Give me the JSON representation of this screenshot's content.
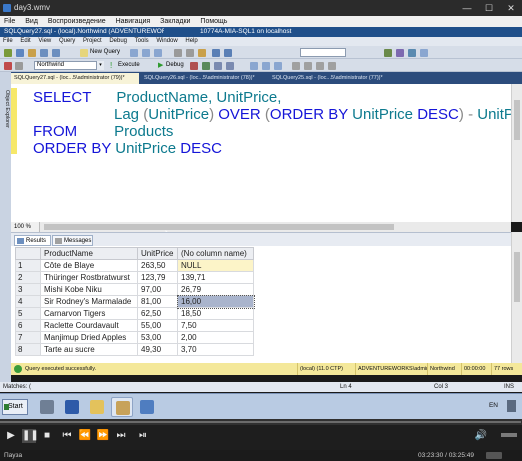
{
  "player": {
    "title": "day3.wmv",
    "menu": [
      "File",
      "Вид",
      "Воспроизведение",
      "Навигация",
      "Закладки",
      "Помощь"
    ],
    "status_text": "Пауза",
    "time_text": "03:23:30 / 03:25:49"
  },
  "ssms": {
    "title": "SQLQuery27.sql - (local).Northwind (ADVENTUREWORKS\\administrator (79))* - Microsoft SQL Server Management Studio",
    "remote_title": "10774A-MIA-SQL1 on localhost",
    "menu": [
      "File",
      "Edit",
      "View",
      "Query",
      "Project",
      "Debug",
      "Tools",
      "Window",
      "Help"
    ],
    "toolbar": {
      "new_query_label": "New Query",
      "database_value": "Northwind",
      "execute_label": "Execute",
      "debug_label": "Debug"
    },
    "tabs": [
      "SQLQuery27.sql - (loc...5\\administrator (79))*",
      "SQLQuery26.sql - (loc...5\\administrator (78))*",
      "SQLQuery25.sql - (loc...5\\administrator (77))*"
    ],
    "object_explorer_label": "Object Explorer",
    "zoom": "100 %",
    "sql": {
      "line1_kw": "SELECT",
      "line1_cols": "ProductName, UnitPrice,",
      "line2_fn": "Lag",
      "line2_open": "(",
      "line2_arg": "UnitPrice",
      "line2_close": ")",
      "line2_over": "OVER",
      "line2_paren_open": "(",
      "line2_orderby": "ORDER BY",
      "line2_col": "UnitPrice",
      "line2_desc": "DESC",
      "line2_paren_close": ")",
      "line2_minus": "-",
      "line2_tail": "UnitP",
      "line3_kw": "FROM",
      "line3_tbl": "Products",
      "line4_kw": "ORDER BY",
      "line4_col": "UnitPrice",
      "line4_desc": "DESC"
    },
    "results_tabs": [
      "Results",
      "Messages"
    ],
    "grid": {
      "columns": [
        "ProductName",
        "UnitPrice",
        "(No column name)"
      ],
      "rows": [
        {
          "n": "1",
          "name": "Côte de Blaye",
          "price": "263,50",
          "diff": "NULL"
        },
        {
          "n": "2",
          "name": "Thüringer Rostbratwurst",
          "price": "123,79",
          "diff": "139,71"
        },
        {
          "n": "3",
          "name": "Mishi Kobe Niku",
          "price": "97,00",
          "diff": "26,79"
        },
        {
          "n": "4",
          "name": "Sir Rodney's Marmalade",
          "price": "81,00",
          "diff": "16,00"
        },
        {
          "n": "5",
          "name": "Carnarvon Tigers",
          "price": "62,50",
          "diff": "18,50"
        },
        {
          "n": "6",
          "name": "Raclette Courdavault",
          "price": "55,00",
          "diff": "7,50"
        },
        {
          "n": "7",
          "name": "Manjimup Dried Apples",
          "price": "53,00",
          "diff": "2,00"
        },
        {
          "n": "8",
          "name": "Tarte au sucre",
          "price": "49,30",
          "diff": "3,70"
        }
      ]
    },
    "status": {
      "message": "Query executed successfully.",
      "server": "(local) (11.0 CTP)",
      "login": "ADVENTUREWORKS\\adminis...",
      "database": "Northwind",
      "elapsed": "00:00:00",
      "rows": "77 rows"
    },
    "bottom_status": {
      "matches": "Matches: (",
      "ln": "Ln 4",
      "col": "Col 3",
      "ins": "INS"
    }
  },
  "taskbar": {
    "start_label": "Start",
    "lang": "EN"
  }
}
